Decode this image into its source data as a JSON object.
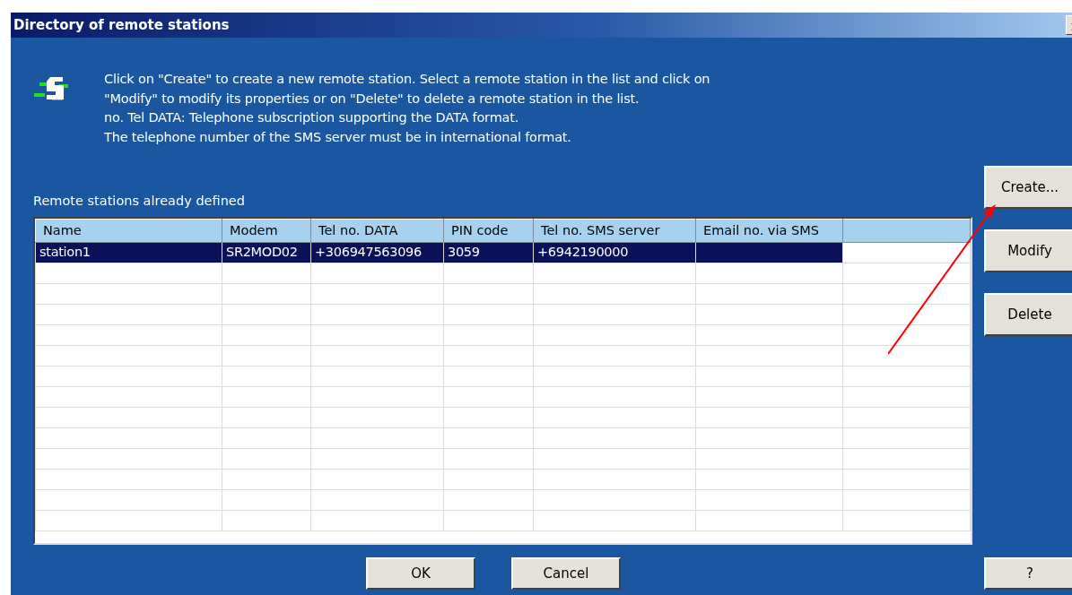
{
  "window": {
    "title": "Directory of remote stations"
  },
  "instructions": [
    "Click on  \"Create\" to create a new remote station. Select a remote station in the list and click on",
    "\"Modify\" to modify its properties or on  \"Delete\" to delete a remote station in the list.",
    "no. Tel DATA: Telephone subscription supporting the DATA format.",
    "The telephone number of the SMS server must be in international format."
  ],
  "list_label": "Remote stations already defined",
  "table": {
    "columns": [
      "Name",
      "Modem",
      "Tel no. DATA",
      "PIN code",
      "Tel no. SMS server",
      "Email no. via SMS"
    ],
    "rows": [
      {
        "cells": [
          "station1",
          "SR2MOD02",
          "+306947563096",
          "3059",
          "+6942190000",
          ""
        ],
        "selected": true
      }
    ]
  },
  "side_buttons": [
    "Create...",
    "Modify",
    "Delete"
  ],
  "bottom_buttons": [
    "OK",
    "Cancel"
  ],
  "help_button": "?"
}
